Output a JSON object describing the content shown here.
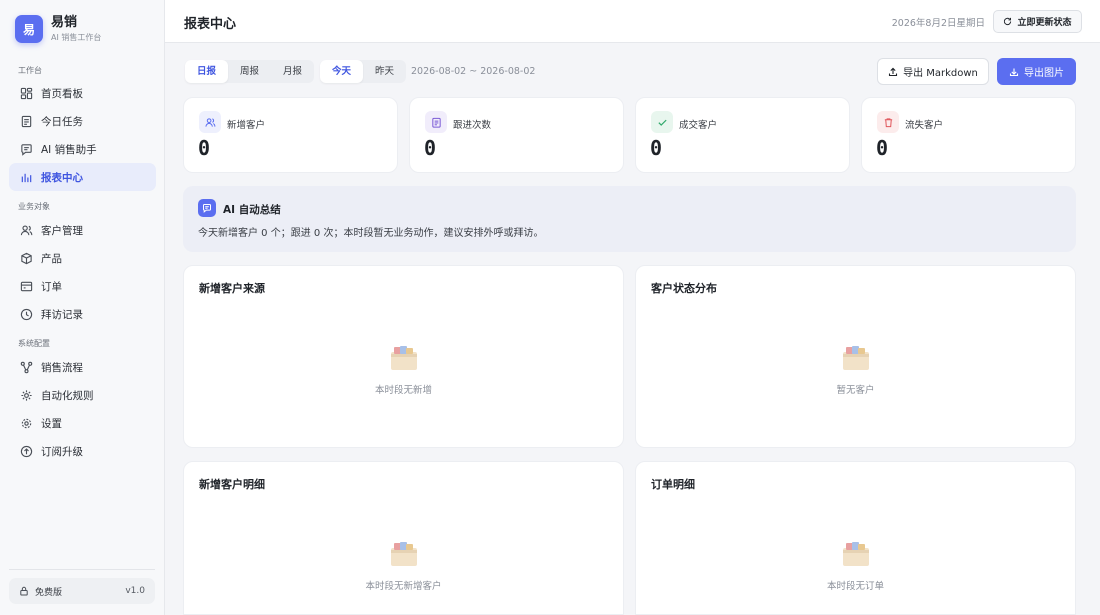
{
  "brand": {
    "logo_text": "易",
    "name": "易销",
    "subtitle": "AI 销售工作台"
  },
  "sidebar": {
    "sections": [
      {
        "title": "工作台",
        "items": [
          {
            "label": "首页看板",
            "icon": "dashboard-icon"
          },
          {
            "label": "今日任务",
            "icon": "task-icon"
          },
          {
            "label": "AI 销售助手",
            "icon": "chat-icon"
          },
          {
            "label": "报表中心",
            "icon": "bar-chart-icon",
            "active": true
          }
        ]
      },
      {
        "title": "业务对象",
        "items": [
          {
            "label": "客户管理",
            "icon": "users-icon"
          },
          {
            "label": "产品",
            "icon": "box-icon"
          },
          {
            "label": "订单",
            "icon": "order-icon"
          },
          {
            "label": "拜访记录",
            "icon": "clock-icon"
          }
        ]
      },
      {
        "title": "系统配置",
        "items": [
          {
            "label": "销售流程",
            "icon": "flow-icon"
          },
          {
            "label": "自动化规则",
            "icon": "automation-icon"
          },
          {
            "label": "设置",
            "icon": "gear-icon"
          },
          {
            "label": "订阅升级",
            "icon": "upgrade-icon"
          }
        ]
      }
    ],
    "plan": {
      "label": "免费版",
      "version": "v1.0"
    }
  },
  "header": {
    "title": "报表中心",
    "date": "2026年8月2日星期日",
    "refresh_label": "立即更新状态"
  },
  "filters": {
    "period_tabs": [
      "日报",
      "周报",
      "月报"
    ],
    "day_tabs": [
      "今天",
      "昨天"
    ],
    "range": "2026-08-02 ~ 2026-08-02"
  },
  "actions": {
    "export_markdown": "导出 Markdown",
    "export_image": "导出图片"
  },
  "stats": [
    {
      "label": "新增客户",
      "value": "0",
      "color": "#5b6ef0",
      "bg": "#eef0fd"
    },
    {
      "label": "跟进次数",
      "value": "0",
      "color": "#7b5bd6",
      "bg": "#f1edfb"
    },
    {
      "label": "成交客户",
      "value": "0",
      "color": "#2fa86a",
      "bg": "#e8f6ee"
    },
    {
      "label": "流失客户",
      "value": "0",
      "color": "#e0565b",
      "bg": "#fcecec"
    }
  ],
  "ai_summary": {
    "title": "AI 自动总结",
    "text": "今天新增客户 0 个；跟进 0 次；本时段暂无业务动作，建议安排外呼或拜访。"
  },
  "panels": [
    {
      "title": "新增客户来源",
      "empty": "本时段无新增"
    },
    {
      "title": "客户状态分布",
      "empty": "暂无客户"
    },
    {
      "title": "新增客户明细",
      "empty": "本时段无新增客户"
    },
    {
      "title": "订单明细",
      "empty": "本时段无订单"
    }
  ]
}
